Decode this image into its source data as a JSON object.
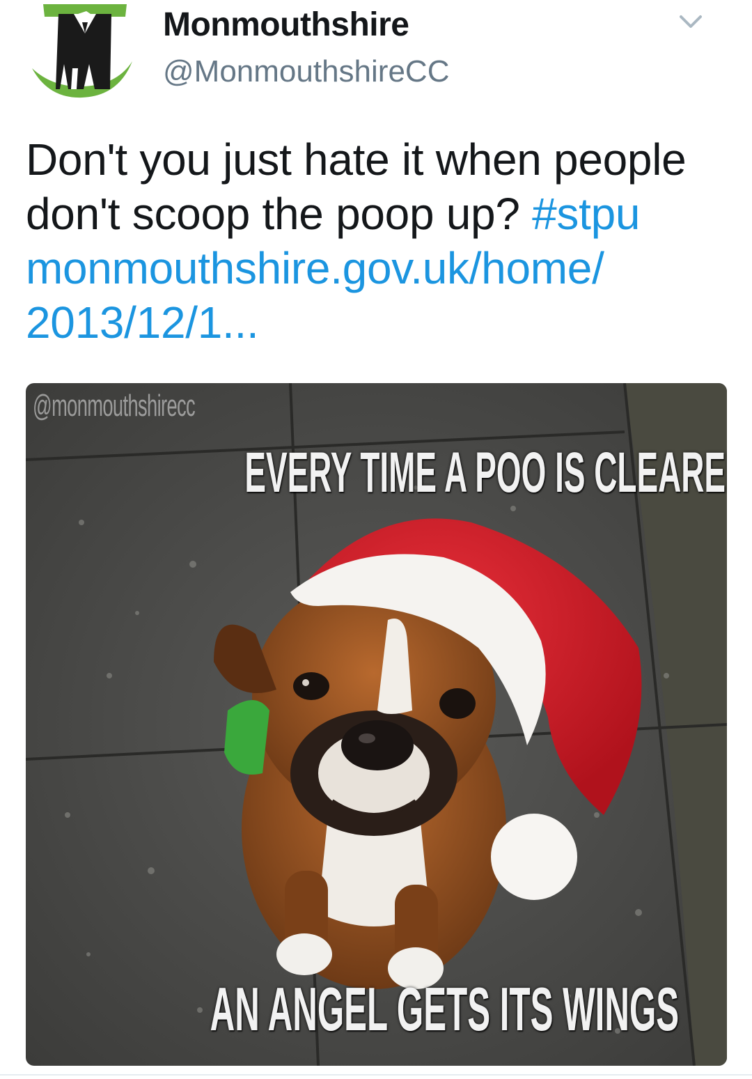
{
  "account": {
    "display_name": "Monmouthshire",
    "handle": "@MonmouthshireCC",
    "avatar_icon": "monmouthshire-council-logo-icon"
  },
  "tweet": {
    "text": "Don't you just hate it when people don't scoop the poop up?",
    "hashtag": "#stpu",
    "link_line1": "monmouthshire.gov.uk/home/",
    "link_line2": "2013/12/1..."
  },
  "media": {
    "watermark": "@monmouthshirecc",
    "top_caption": "EVERY TIME A POO IS CLEARED UP",
    "bottom_caption": "AN ANGEL GETS ITS WINGS"
  },
  "menu": {
    "icon": "chevron-down-icon"
  },
  "colors": {
    "link": "#1b95e0",
    "handle": "#657786",
    "logo_green": "#6cb33f",
    "text": "#14171a"
  }
}
